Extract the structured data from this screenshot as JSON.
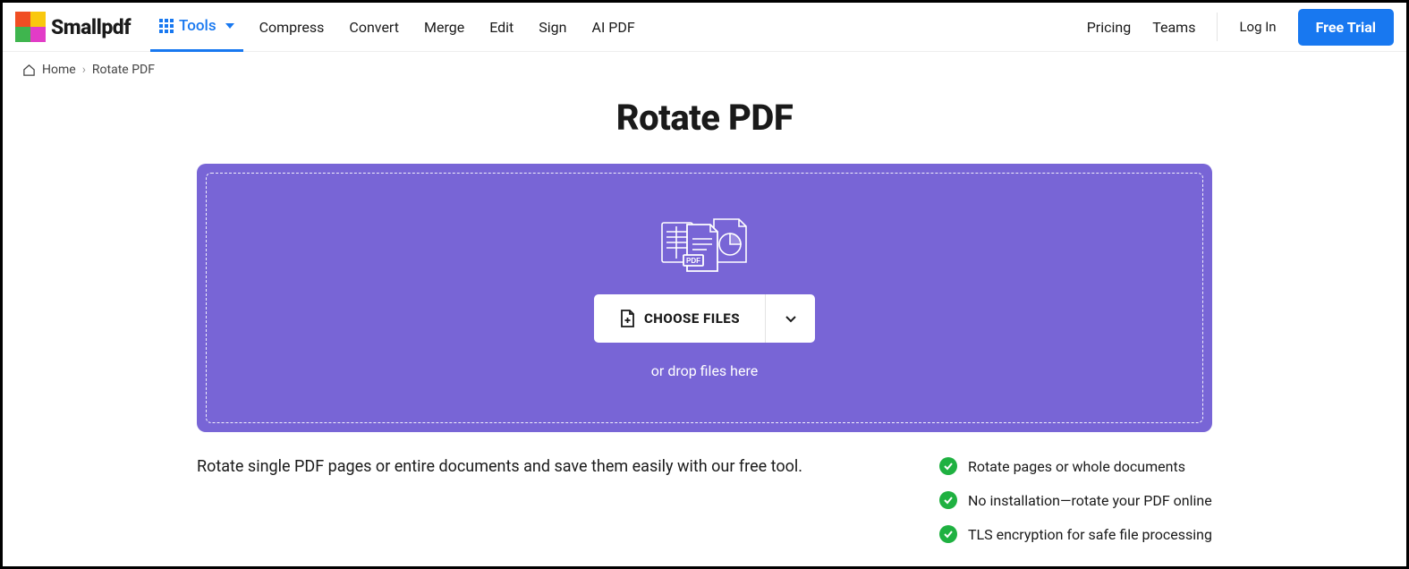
{
  "brand": {
    "name": "Smallpdf"
  },
  "nav": {
    "tools_label": "Tools",
    "links": [
      "Compress",
      "Convert",
      "Merge",
      "Edit",
      "Sign",
      "AI PDF"
    ],
    "pricing": "Pricing",
    "teams": "Teams",
    "login": "Log In",
    "free_trial": "Free Trial"
  },
  "breadcrumb": {
    "home": "Home",
    "current": "Rotate PDF"
  },
  "page": {
    "title": "Rotate PDF",
    "choose_files": "CHOOSE FILES",
    "or_drop": "or drop files here",
    "subtitle": "Rotate single PDF pages or entire documents and save them easily with our free tool.",
    "features": [
      "Rotate pages or whole documents",
      "No installation—rotate your PDF online",
      "TLS encryption for safe file processing"
    ]
  }
}
